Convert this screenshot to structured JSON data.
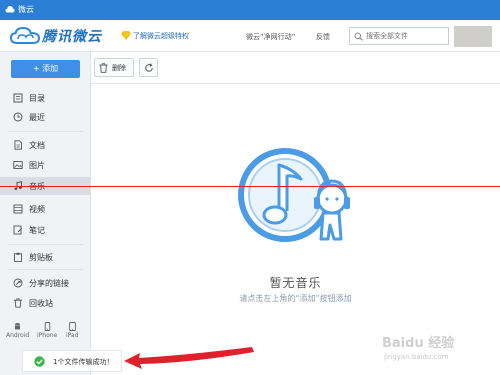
{
  "window": {
    "title": "微云",
    "app_icon": "cloud-icon"
  },
  "header": {
    "logo_text": "腾讯微云",
    "vip_link": "了解微云超级特权",
    "nav": [
      "微云“净网行动”",
      "反馈"
    ],
    "search": {
      "placeholder": "搜索全部文件",
      "value": ""
    }
  },
  "sidebar": {
    "add_label": "添加",
    "items": [
      {
        "label": "目录",
        "icon": "directory-icon"
      },
      {
        "label": "最近",
        "icon": "clock-icon"
      },
      {
        "label": "文档",
        "icon": "document-icon"
      },
      {
        "label": "图片",
        "icon": "image-icon"
      },
      {
        "label": "音乐",
        "icon": "music-icon",
        "active": true
      },
      {
        "label": "视频",
        "icon": "video-icon"
      },
      {
        "label": "笔记",
        "icon": "note-icon"
      },
      {
        "label": "剪贴板",
        "icon": "clipboard-icon"
      },
      {
        "label": "分享的链接",
        "icon": "share-icon"
      },
      {
        "label": "回收站",
        "icon": "trash-icon"
      }
    ],
    "devices": [
      "Android",
      "iPhone",
      "iPad"
    ]
  },
  "toolbar": {
    "delete_label": "删除"
  },
  "empty_state": {
    "title": "暂无音乐",
    "hint": "请点击左上角的“添加”按钮添加"
  },
  "status": {
    "message": "1个文件传输成功！"
  },
  "watermark": {
    "line1": "Baidu 经验",
    "line2": "jingyan.baidu.com"
  },
  "colors": {
    "titlebar": "#2a7fd4",
    "accent": "#3f8ee7",
    "annotation_red": "#e0202a",
    "success": "#3bb54a"
  }
}
